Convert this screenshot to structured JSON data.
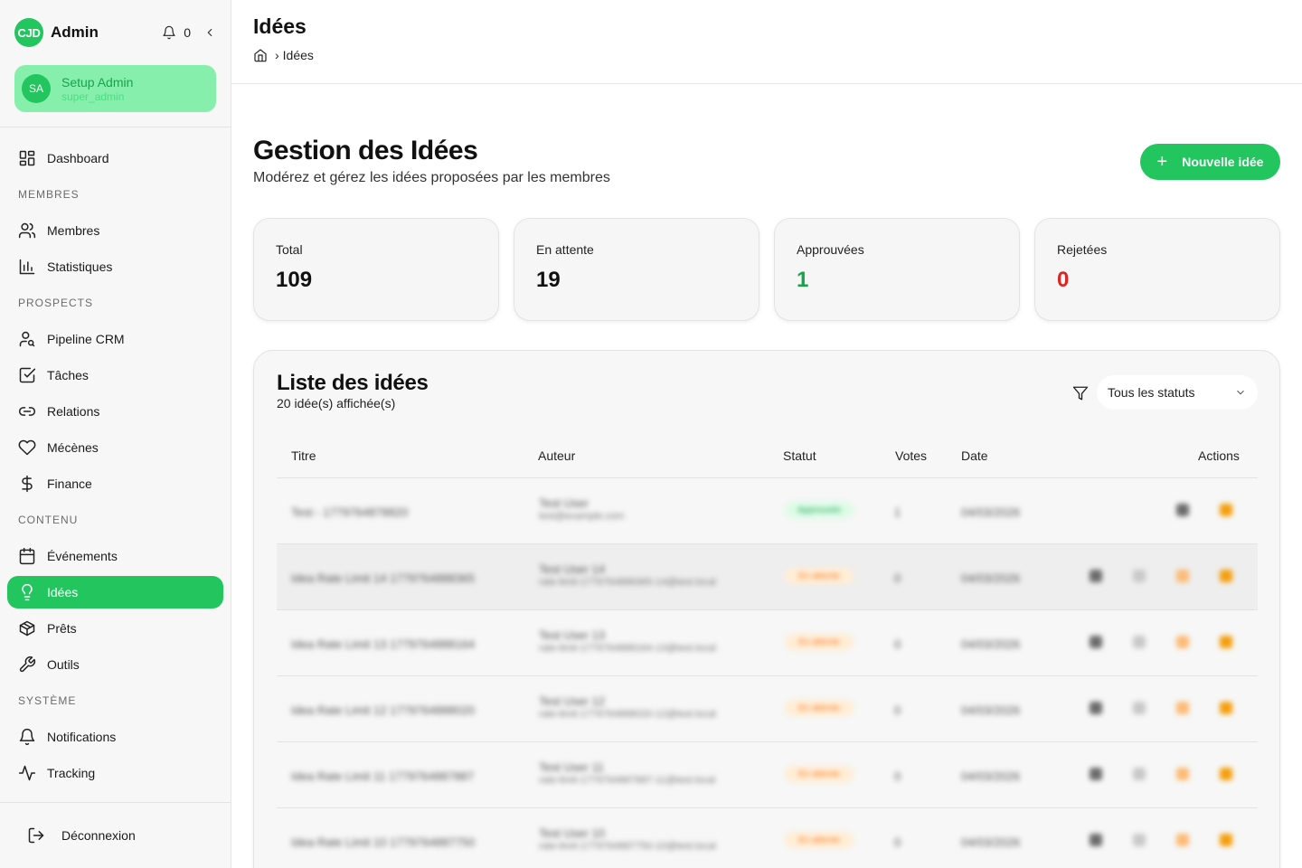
{
  "app": {
    "logo_text": "CJD",
    "title": "Admin",
    "notif_count": "0"
  },
  "user": {
    "initials": "SA",
    "name": "Setup Admin",
    "role": "super_admin"
  },
  "sidebar": {
    "dashboard": "Dashboard",
    "sections": {
      "membres": "MEMBRES",
      "prospects": "PROSPECTS",
      "contenu": "CONTENU",
      "systeme": "SYSTÈME"
    },
    "items": {
      "membres": "Membres",
      "statistiques": "Statistiques",
      "pipeline": "Pipeline CRM",
      "taches": "Tâches",
      "relations": "Relations",
      "mecenes": "Mécènes",
      "finance": "Finance",
      "evenements": "Événements",
      "idees": "Idées",
      "prets": "Prêts",
      "outils": "Outils",
      "notifications": "Notifications",
      "tracking": "Tracking"
    },
    "logout": "Déconnexion"
  },
  "header": {
    "title": "Idées",
    "breadcrumb_current": "Idées"
  },
  "hero": {
    "title": "Gestion des Idées",
    "subtitle": "Modérez et gérez les idées proposées par les membres",
    "new_button": "Nouvelle idée"
  },
  "stats": [
    {
      "label": "Total",
      "value": "109",
      "color": "#111111"
    },
    {
      "label": "En attente",
      "value": "19",
      "color": "#111111"
    },
    {
      "label": "Approuvées",
      "value": "1",
      "color": "#16a34a"
    },
    {
      "label": "Rejetées",
      "value": "0",
      "color": "#dc2626"
    }
  ],
  "list": {
    "title": "Liste des idées",
    "count": "20 idée(s) affichée(s)",
    "filter_value": "Tous les statuts",
    "columns": {
      "titre": "Titre",
      "auteur": "Auteur",
      "statut": "Statut",
      "votes": "Votes",
      "date": "Date",
      "actions": "Actions"
    },
    "rows": [
      {
        "title": "Test - 1779764878820",
        "author": "Test User",
        "email": "test@example.com",
        "status": "Approuvée",
        "status_bg": "#dcfce7",
        "status_fg": "#16a34a",
        "votes": "1",
        "date": "04/03/2026",
        "shaded": false,
        "actions": 2
      },
      {
        "title": "Idea Rate Limit 14 1779764888365",
        "author": "Test User 14",
        "email": "rate-limit-1779764888365-14@test.local",
        "status": "En attente",
        "status_bg": "#ffedd5",
        "status_fg": "#f97316",
        "votes": "0",
        "date": "04/03/2026",
        "shaded": true,
        "actions": 4
      },
      {
        "title": "Idea Rate Limit 13 1779764888164",
        "author": "Test User 13",
        "email": "rate-limit-1779764888164-13@test.local",
        "status": "En attente",
        "status_bg": "#ffedd5",
        "status_fg": "#f97316",
        "votes": "0",
        "date": "04/03/2026",
        "shaded": false,
        "actions": 4
      },
      {
        "title": "Idea Rate Limit 12 1779764888020",
        "author": "Test User 12",
        "email": "rate-limit-1779764888020-12@test.local",
        "status": "En attente",
        "status_bg": "#ffedd5",
        "status_fg": "#f97316",
        "votes": "0",
        "date": "04/03/2026",
        "shaded": false,
        "actions": 4
      },
      {
        "title": "Idea Rate Limit 11 1779764887887",
        "author": "Test User 11",
        "email": "rate-limit-1779764887887-11@test.local",
        "status": "En attente",
        "status_bg": "#ffedd5",
        "status_fg": "#f97316",
        "votes": "0",
        "date": "04/03/2026",
        "shaded": false,
        "actions": 4
      },
      {
        "title": "Idea Rate Limit 10 1779764887750",
        "author": "Test User 10",
        "email": "rate-limit-1779764887750-10@test.local",
        "status": "En attente",
        "status_bg": "#ffedd5",
        "status_fg": "#f97316",
        "votes": "0",
        "date": "04/03/2026",
        "shaded": false,
        "actions": 4
      }
    ]
  }
}
